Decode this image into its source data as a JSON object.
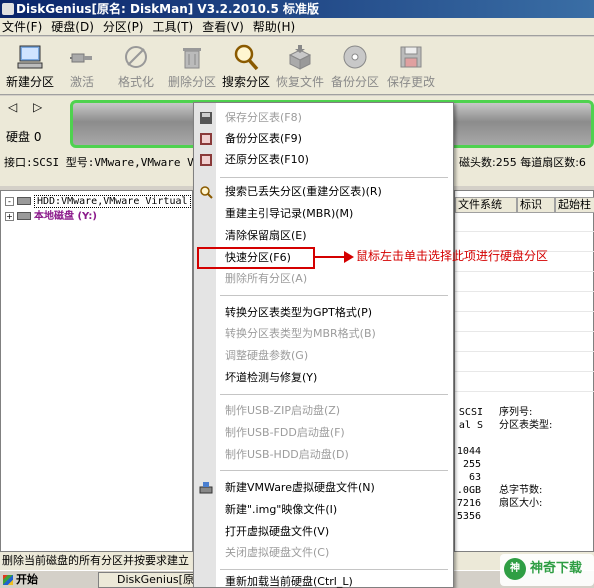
{
  "window": {
    "title": "DiskGenius[原名: DiskMan] V3.2.2010.5 标准版"
  },
  "menubar": {
    "items": [
      {
        "label": "文件(F)"
      },
      {
        "label": "硬盘(D)"
      },
      {
        "label": "分区(P)"
      },
      {
        "label": "工具(T)"
      },
      {
        "label": "查看(V)"
      },
      {
        "label": "帮助(H)"
      }
    ]
  },
  "toolbar": {
    "buttons": [
      {
        "label": "新建分区",
        "icon": "computer-icon"
      },
      {
        "label": "激活",
        "icon": "plug-icon"
      },
      {
        "label": "格式化",
        "icon": "format-icon"
      },
      {
        "label": "删除分区",
        "icon": "trash-icon"
      },
      {
        "label": "搜索分区",
        "icon": "magnifier-icon"
      },
      {
        "label": "恢复文件",
        "icon": "restore-box-icon"
      },
      {
        "label": "备份分区",
        "icon": "backup-disc-icon"
      },
      {
        "label": "保存更改",
        "icon": "save-icon"
      }
    ]
  },
  "disk_panel": {
    "nav_arrows": "◁ ▷",
    "disk_label": "硬盘 0",
    "interface": "接口:SCSI  型号:VMware,VMware Virtual S",
    "right_info": "磁头数:255  每道扇区数:6"
  },
  "tree": {
    "items": [
      {
        "label": "HDD:VMware,VMware Virtual"
      },
      {
        "label": "本地磁盘 (Y:)"
      }
    ]
  },
  "right_pane": {
    "columns": [
      {
        "label": "文件系统"
      },
      {
        "label": "标识"
      },
      {
        "label": "起始柱"
      }
    ],
    "values_left": [
      "SCSI",
      "al S",
      "",
      "1044",
      "255",
      "63",
      ".0GB",
      "7216",
      "5356"
    ],
    "labels_right": [
      "序列号:",
      "分区表类型:",
      "",
      "",
      "",
      "",
      "总字节数:",
      "扇区大小:",
      ""
    ]
  },
  "context_menu": {
    "items": [
      {
        "label": "保存分区表(F8)",
        "enabled": false,
        "icon": "save-table-icon"
      },
      {
        "label": "备份分区表(F9)",
        "enabled": true,
        "icon": "backup-table-icon"
      },
      {
        "label": "还原分区表(F10)",
        "enabled": true,
        "icon": "restore-table-icon"
      },
      {
        "label": "搜索已丢失分区(重建分区表)(R)",
        "enabled": true,
        "icon": "search-lost-icon"
      },
      {
        "label": "重建主引导记录(MBR)(M)",
        "enabled": true
      },
      {
        "label": "清除保留扇区(E)",
        "enabled": true
      },
      {
        "label": "快速分区(F6)",
        "enabled": true
      },
      {
        "label": "删除所有分区(A)",
        "enabled": false
      },
      {
        "label": "转换分区表类型为GPT格式(P)",
        "enabled": true
      },
      {
        "label": "转换分区表类型为MBR格式(B)",
        "enabled": false
      },
      {
        "label": "调整硬盘参数(G)",
        "enabled": false
      },
      {
        "label": "坏道检测与修复(Y)",
        "enabled": true
      },
      {
        "label": "制作USB-ZIP启动盘(Z)",
        "enabled": false
      },
      {
        "label": "制作USB-FDD启动盘(F)",
        "enabled": false
      },
      {
        "label": "制作USB-HDD启动盘(D)",
        "enabled": false
      },
      {
        "label": "新建VMWare虚拟硬盘文件(N)",
        "enabled": true,
        "icon": "new-vdisk-icon"
      },
      {
        "label": "新建\".img\"映像文件(I)",
        "enabled": true
      },
      {
        "label": "打开虚拟硬盘文件(V)",
        "enabled": true
      },
      {
        "label": "关闭虚拟硬盘文件(C)",
        "enabled": false
      },
      {
        "label": "重新加载当前硬盘(Ctrl_L)",
        "enabled": true
      }
    ]
  },
  "annotation": {
    "text": "鼠标左击单击选择此项进行硬盘分区",
    "color": "#d40000"
  },
  "statusbar": {
    "text": "删除当前磁盘的所有分区并按要求建立"
  },
  "taskbar": {
    "start_label": "开始",
    "task_label": "DiskGenius[原"
  },
  "watermark": {
    "badge": "神",
    "text": "神奇下载"
  },
  "colors": {
    "disk_border": "#4fd24f",
    "title_bar": "#0a246a",
    "annotation_red": "#d40000"
  }
}
